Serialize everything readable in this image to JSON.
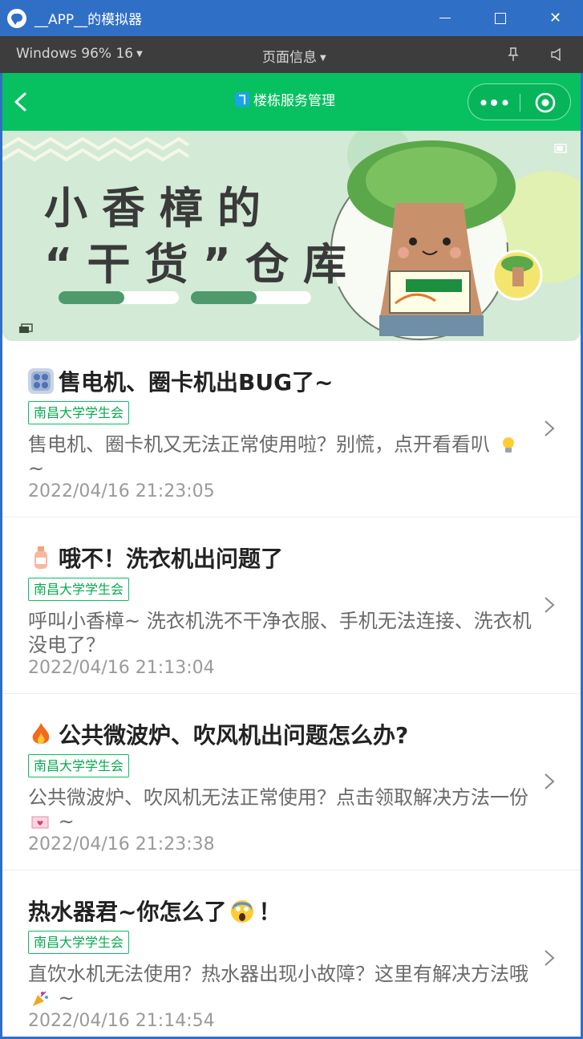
{
  "window": {
    "title": "__APP__的模拟器",
    "minimize_label": "",
    "maximize_label": "",
    "close_label": "✕"
  },
  "toolbar": {
    "device_label": "Windows 96% 16",
    "page_info_label": "页面信息"
  },
  "navbar": {
    "title": "楼栋服务管理"
  },
  "banner": {
    "line1": "小香樟的",
    "line2": "“干货”仓库"
  },
  "items": [
    {
      "title": "售电机、圈卡机出BUG了~",
      "title_icon": "device-icon",
      "tag": "南昌大学学生会",
      "desc_main": "售电机、圈卡机又无法正常使用啦？别慌，点开看看叭",
      "desc_icon": "lightbulb-icon",
      "desc_tail": "~",
      "time": "2022/04/16 21:23:05"
    },
    {
      "title": "哦不！洗衣机出问题了",
      "title_icon": "lotion-bottle-icon",
      "tag": "南昌大学学生会",
      "desc_main": "呼叫小香樟~ 洗衣机洗不干净衣服、手机无法连接、洗衣机没电了？",
      "desc_icon": "",
      "desc_tail": "",
      "time": "2022/04/16 21:13:04"
    },
    {
      "title": "公共微波炉、吹风机出问题怎么办?",
      "title_icon": "fire-icon",
      "tag": "南昌大学学生会",
      "desc_main": "公共微波炉、吹风机无法正常使用？点击领取解决方法一份",
      "desc_icon": "love-letter-icon",
      "desc_tail": "~",
      "time": "2022/04/16 21:23:38"
    },
    {
      "title": "热水器君~你怎么了",
      "title_icon": "",
      "title_suffix_icon": "screaming-face-icon",
      "title_suffix": "！",
      "tag": "南昌大学学生会",
      "desc_main": "直饮水机无法使用？热水器出现小故障？这里有解决方法哦",
      "desc_icon": "party-popper-icon",
      "desc_tail": "~",
      "time": "2022/04/16 21:14:54"
    }
  ],
  "colors": {
    "window_blue": "#2f6fc6",
    "toolbar_dark": "#3d3d3d",
    "wechat_green": "#07c160",
    "banner_bg": "#d3ead6"
  }
}
